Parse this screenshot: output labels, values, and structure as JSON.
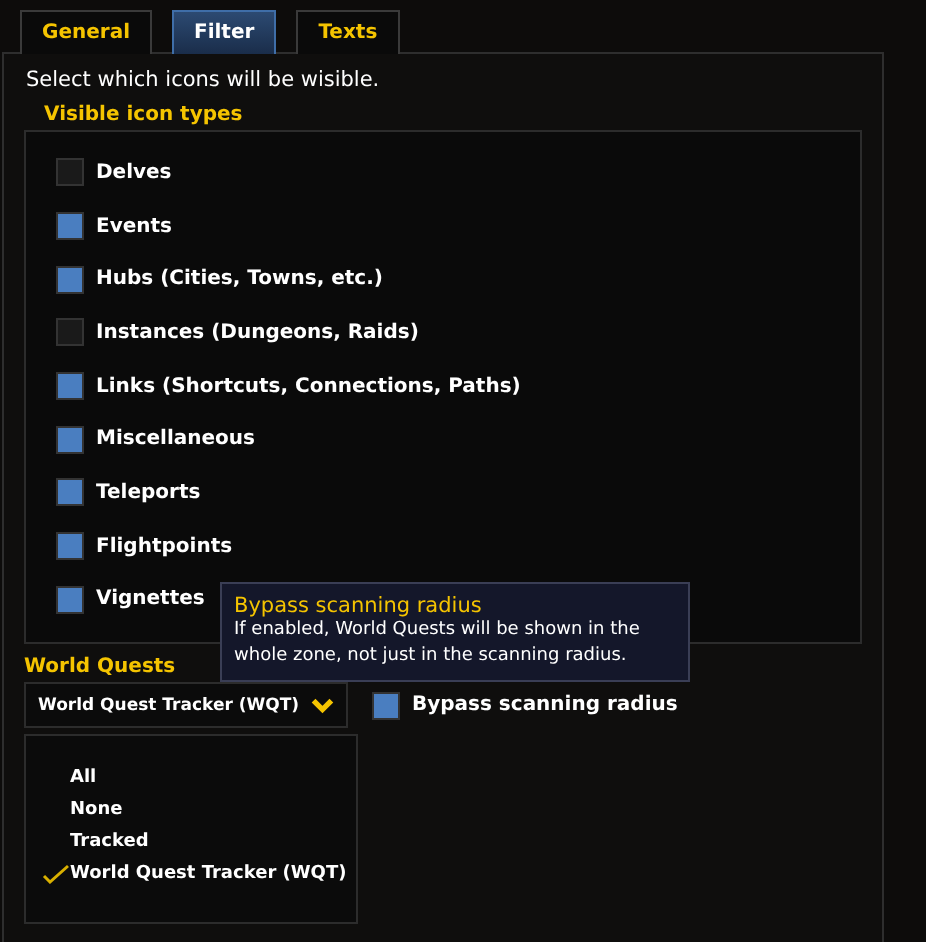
{
  "tabs": [
    {
      "label": "General",
      "selected": false
    },
    {
      "label": "Filter",
      "selected": true
    },
    {
      "label": "Texts",
      "selected": false
    }
  ],
  "intro": "Select which icons will be wisible.",
  "icon_types": {
    "title": "Visible icon types",
    "items": [
      {
        "label": "Delves",
        "checked": false
      },
      {
        "label": "Events",
        "checked": true
      },
      {
        "label": "Hubs (Cities, Towns, etc.)",
        "checked": true
      },
      {
        "label": "Instances (Dungeons, Raids)",
        "checked": false
      },
      {
        "label": "Links (Shortcuts, Connections, Paths)",
        "checked": true
      },
      {
        "label": "Miscellaneous",
        "checked": true
      },
      {
        "label": "Teleports",
        "checked": true
      },
      {
        "label": "Flightpoints",
        "checked": true
      },
      {
        "label": "Vignettes",
        "checked": true
      }
    ]
  },
  "world_quests": {
    "title": "World Quests",
    "dropdown": {
      "value": "World Quest Tracker (WQT)",
      "options": [
        {
          "label": "All",
          "selected": false
        },
        {
          "label": "None",
          "selected": false
        },
        {
          "label": "Tracked",
          "selected": false
        },
        {
          "label": "World Quest Tracker (WQT)",
          "selected": true
        }
      ]
    },
    "bypass": {
      "label": "Bypass scanning radius",
      "checked": true
    }
  },
  "tooltip": {
    "title": "Bypass scanning radius",
    "text": "If enabled, World Quests will be shown in the whole zone, not just in the scanning radius."
  }
}
